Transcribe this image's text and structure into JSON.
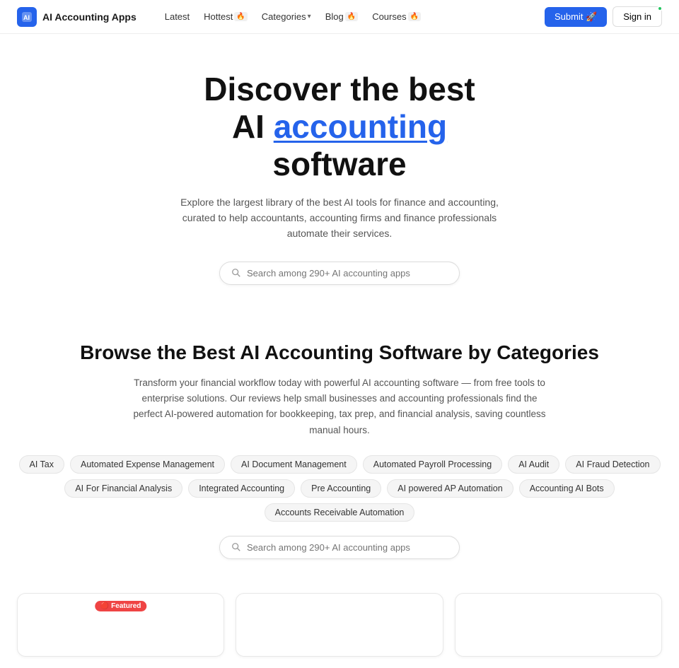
{
  "site": {
    "name": "AI Accounting Apps",
    "logo_alt": "AI Accounting Apps logo"
  },
  "nav": {
    "links": [
      {
        "label": "Latest",
        "badge": null
      },
      {
        "label": "Hottest",
        "badge": "🔥"
      },
      {
        "label": "Categories",
        "badge": "▾"
      },
      {
        "label": "Blog",
        "badge": "🔥"
      },
      {
        "label": "Courses",
        "badge": "🔥"
      }
    ],
    "submit_label": "Submit 🚀",
    "signin_label": "Sign in"
  },
  "hero": {
    "title_line1": "Discover the best",
    "title_line2_plain": "AI ",
    "title_line2_highlight": "accounting",
    "title_line3": "software",
    "subtitle": "Explore the largest library of the best AI tools for finance and accounting, curated to help accountants, accounting firms and finance professionals automate their services.",
    "search_placeholder": "Search among 290+ AI accounting apps"
  },
  "categories": {
    "title": "Browse the Best AI Accounting Software by Categories",
    "description": "Transform your financial workflow today with powerful AI accounting software — from free tools to enterprise solutions. Our reviews help small businesses and accounting professionals find the perfect AI-powered automation for bookkeeping, tax prep, and financial analysis, saving countless manual hours.",
    "tags": [
      "AI Tax",
      "Automated Expense Management",
      "AI Document Management",
      "Automated Payroll Processing",
      "AI Audit",
      "AI Fraud Detection",
      "AI For Financial Analysis",
      "Integrated Accounting",
      "Pre Accounting",
      "AI powered AP Automation",
      "Accounting AI Bots",
      "Accounts Receivable Automation"
    ],
    "search_placeholder": "Search among 290+ AI accounting apps"
  },
  "cards": [
    {
      "featured": true
    },
    {
      "featured": false
    },
    {
      "featured": false
    }
  ],
  "colors": {
    "accent": "#2563eb",
    "featured_badge": "#ef4444",
    "highlight_text": "#2563eb"
  }
}
